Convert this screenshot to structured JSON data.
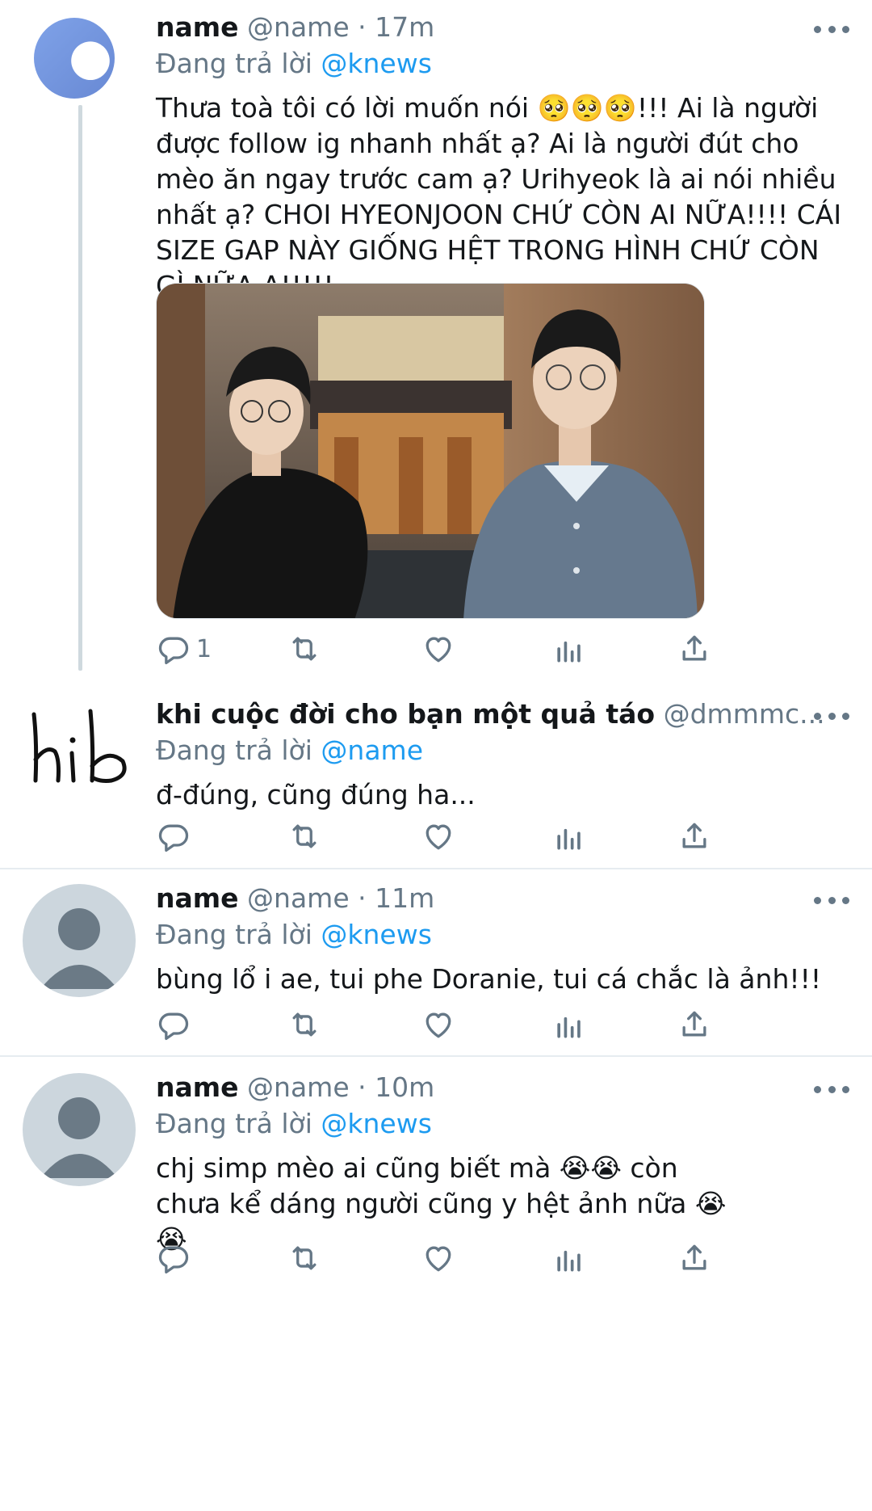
{
  "tweets": [
    {
      "name": "name",
      "handle": "@name",
      "time": "· 17m",
      "reply_prefix": "Đang trả lời",
      "reply_to": "@knews",
      "text": "Thưa toà tôi có lời muốn nói 🥺🥺🥺!!! Ai là người được follow ig nhanh nhất ạ? Ai là người đút cho mèo ăn ngay trước cam ạ? Urihyeok là ai nói nhiều nhất ạ? CHOI HYEONJOON CHỨ CÒN AI NỮA!!!! CÁI SIZE GAP NÀY GIỐNG HỆT TRONG HÌNH CHỨ CÒN GÌ NỮA Ạ!!!!!",
      "reply_count": "1",
      "avatar_color": "#6f8fd6"
    },
    {
      "name": "khi cuộc đời cho bạn một quả táo",
      "handle": "@dmmmc...",
      "reply_prefix": "Đang trả lời",
      "reply_to": "@name",
      "text": "đ-đúng, cũng đúng ha...",
      "handwritten_label": "hib"
    },
    {
      "name": "name",
      "handle": "@name",
      "time": "· 11m",
      "reply_prefix": "Đang trả lời",
      "reply_to": "@knews",
      "text": "bùng lổ i ae, tui phe Doranie, tui cá chắc là ảnh!!!"
    },
    {
      "name": "name",
      "handle": "@name",
      "time": "· 10m",
      "reply_prefix": "Đang trả lời",
      "reply_to": "@knews",
      "text": "chj simp mèo ai cũng biết mà 😭😭 còn chưa kể dáng người cũng y hệt ảnh nữa 😭😭"
    }
  ],
  "icons": {
    "reply": "reply-icon",
    "retweet": "retweet-icon",
    "like": "heart-icon",
    "analytics": "analytics-icon",
    "share": "share-icon",
    "more": "more-icon"
  },
  "colors": {
    "link": "#1d9bf0",
    "secondary_text": "#657786",
    "default_avatar_bg": "#ccd6dd",
    "default_avatar_fg": "#6b7a86"
  }
}
